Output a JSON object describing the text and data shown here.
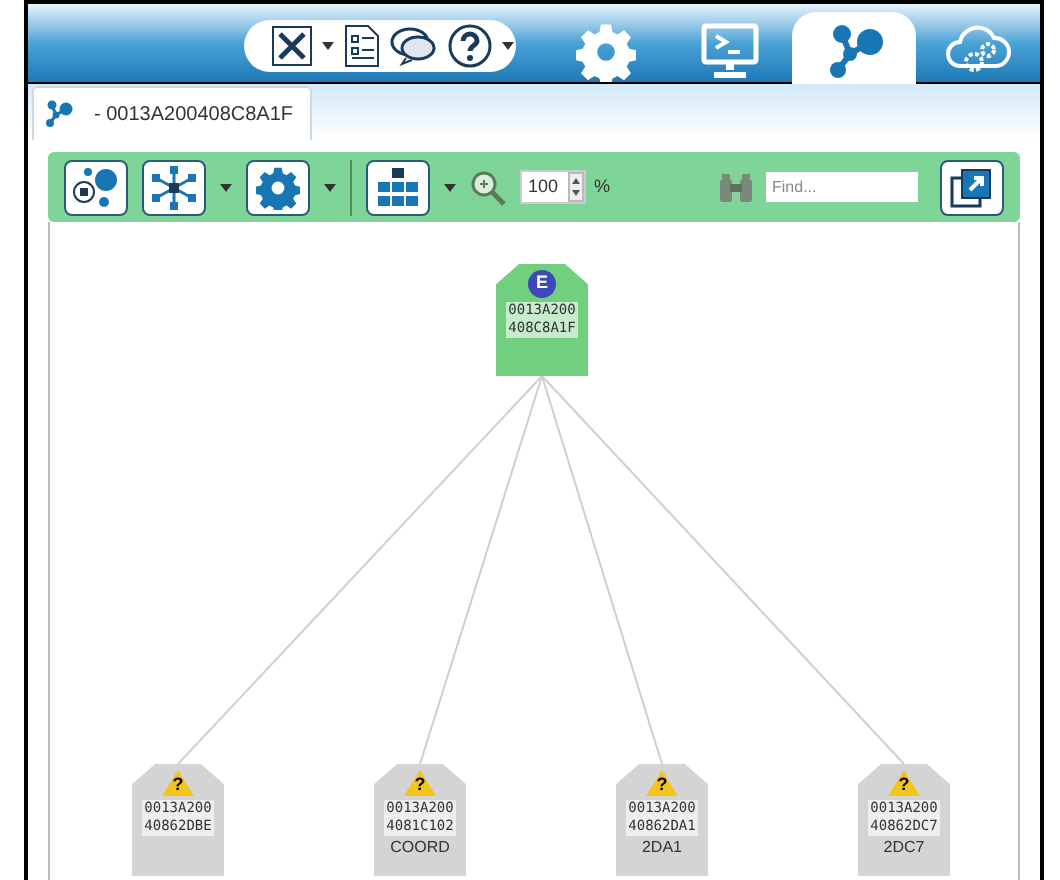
{
  "top_tabs": [
    {
      "kind": "gear",
      "selected": false
    },
    {
      "kind": "console",
      "selected": false
    },
    {
      "kind": "network",
      "selected": true
    },
    {
      "kind": "cloud",
      "selected": false
    }
  ],
  "document_tab": {
    "label": "- 0013A200408C8A1F"
  },
  "toolbar": {
    "zoom": "100",
    "zoom_unit": "%",
    "find": {
      "placeholder": "Find..."
    }
  },
  "coordinator": {
    "kind": "coordinator",
    "badge": "E",
    "address": [
      "0013A200",
      "408C8A1F"
    ]
  },
  "nodes": [
    {
      "kind": "unknown",
      "badge": "?",
      "address": [
        "0013A200",
        "40862DBE"
      ]
    },
    {
      "kind": "unknown",
      "badge": "?",
      "address": [
        "0013A200",
        "4081C102"
      ],
      "name": "COORD"
    },
    {
      "kind": "unknown",
      "badge": "?",
      "address": [
        "0013A200",
        "40862DA1"
      ],
      "name": "2DA1"
    },
    {
      "kind": "unknown",
      "badge": "?",
      "address": [
        "0013A200",
        "40862DC7"
      ],
      "name": "2DC7"
    }
  ]
}
